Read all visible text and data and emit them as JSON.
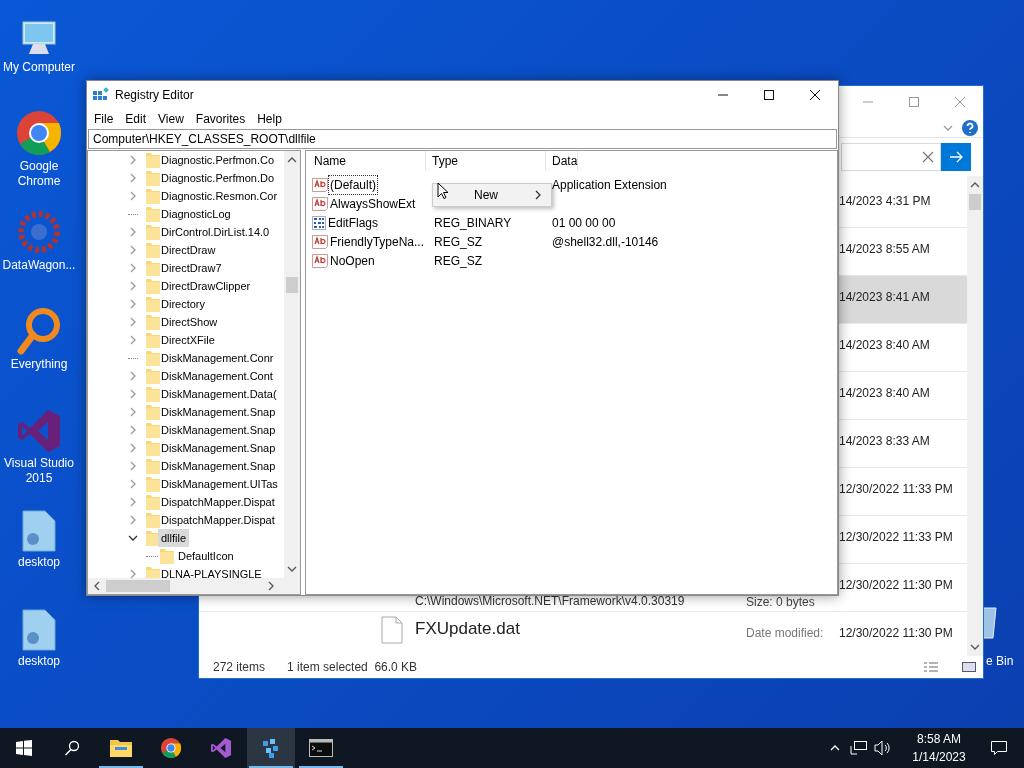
{
  "desktop_icons": [
    {
      "label": "My Computer",
      "kind": "computer"
    },
    {
      "label": "Google Chrome",
      "kind": "chrome"
    },
    {
      "label": "DataWagon...",
      "kind": "datawagon"
    },
    {
      "label": "Everything",
      "kind": "everything"
    },
    {
      "label": "Visual Studio 2015",
      "kind": "vs"
    },
    {
      "label": "desktop",
      "kind": "file"
    },
    {
      "label": "desktop",
      "kind": "file"
    }
  ],
  "recycle_bin": {
    "label": "e Bin"
  },
  "explorer": {
    "items": [
      {
        "date": "14/2023 4:31 PM",
        "selected": false
      },
      {
        "date": "14/2023 8:55 AM",
        "selected": false
      },
      {
        "date": "14/2023 8:41 AM",
        "selected": true
      },
      {
        "date": "14/2023 8:40 AM",
        "selected": false
      },
      {
        "date": "14/2023 8:40 AM",
        "selected": false
      },
      {
        "date": "14/2023 8:33 AM",
        "selected": false
      },
      {
        "date": "12/30/2022 11:33 PM",
        "selected": false
      },
      {
        "date": "12/30/2022 11:33 PM",
        "selected": false
      },
      {
        "date": "12/30/2022 11:30 PM",
        "path": "C:\\Windows\\Microsoft.NET\\Framework\\v4.0.30319",
        "size": "Size: 0 bytes",
        "selected": false
      },
      {
        "name": "FXUpdate.dat",
        "date_label": "Date modified:",
        "date": "12/30/2022 11:30 PM",
        "selected": false
      }
    ],
    "status": {
      "count": "272 items",
      "selection": "1 item selected  66.0 KB"
    }
  },
  "regedit": {
    "title": "Registry Editor",
    "menu": [
      "File",
      "Edit",
      "View",
      "Favorites",
      "Help"
    ],
    "address": "Computer\\HKEY_CLASSES_ROOT\\dllfile",
    "tree": [
      {
        "label": "Diagnostic.Perfmon.Co",
        "kind": "branch",
        "expanded": false,
        "selected": false
      },
      {
        "label": "Diagnostic.Perfmon.Do",
        "kind": "branch",
        "expanded": false,
        "selected": false
      },
      {
        "label": "Diagnostic.Resmon.Cor",
        "kind": "branch",
        "expanded": false,
        "selected": false
      },
      {
        "label": "DiagnosticLog",
        "kind": "leaf",
        "selected": false
      },
      {
        "label": "DirControl.DirList.14.0",
        "kind": "branch",
        "expanded": false,
        "selected": false
      },
      {
        "label": "DirectDraw",
        "kind": "branch",
        "expanded": false,
        "selected": false
      },
      {
        "label": "DirectDraw7",
        "kind": "branch",
        "expanded": false,
        "selected": false
      },
      {
        "label": "DirectDrawClipper",
        "kind": "branch",
        "expanded": false,
        "selected": false
      },
      {
        "label": "Directory",
        "kind": "branch",
        "expanded": false,
        "selected": false
      },
      {
        "label": "DirectShow",
        "kind": "branch",
        "expanded": false,
        "selected": false
      },
      {
        "label": "DirectXFile",
        "kind": "branch",
        "expanded": false,
        "selected": false
      },
      {
        "label": "DiskManagement.Conr",
        "kind": "leaf",
        "selected": false
      },
      {
        "label": "DiskManagement.Cont",
        "kind": "branch",
        "expanded": false,
        "selected": false
      },
      {
        "label": "DiskManagement.Data(",
        "kind": "branch",
        "expanded": false,
        "selected": false
      },
      {
        "label": "DiskManagement.Snap",
        "kind": "branch",
        "expanded": false,
        "selected": false
      },
      {
        "label": "DiskManagement.Snap",
        "kind": "branch",
        "expanded": false,
        "selected": false
      },
      {
        "label": "DiskManagement.Snap",
        "kind": "branch",
        "expanded": false,
        "selected": false
      },
      {
        "label": "DiskManagement.Snap",
        "kind": "branch",
        "expanded": false,
        "selected": false
      },
      {
        "label": "DiskManagement.UITas",
        "kind": "branch",
        "expanded": false,
        "selected": false
      },
      {
        "label": "DispatchMapper.Dispat",
        "kind": "branch",
        "expanded": false,
        "selected": false
      },
      {
        "label": "DispatchMapper.Dispat",
        "kind": "branch",
        "expanded": false,
        "selected": false
      },
      {
        "label": "dllfile",
        "kind": "branch",
        "expanded": true,
        "selected": true,
        "children": [
          {
            "label": "DefaultIcon",
            "selected": false
          }
        ]
      },
      {
        "label": "DLNA-PLAYSINGLE",
        "kind": "branch",
        "expanded": false,
        "selected": false
      }
    ],
    "columns": [
      "Name",
      "Type",
      "Data"
    ],
    "values": [
      {
        "name": "(Default)",
        "kind": "string",
        "data": "Application Extension",
        "focused": true
      },
      {
        "name": "AlwaysShowExt",
        "kind": "string",
        "focused": false
      },
      {
        "name": "EditFlags",
        "kind": "binary",
        "type": "REG_BINARY",
        "data": "01 00 00 00",
        "focused": false
      },
      {
        "name": "FriendlyTypeNa...",
        "kind": "string",
        "type": "REG_SZ",
        "data": "@shell32.dll,-10146",
        "focused": false
      },
      {
        "name": "NoOpen",
        "kind": "string",
        "type": "REG_SZ",
        "focused": false
      }
    ],
    "context_menu": [
      {
        "label": "New",
        "submenu": true
      }
    ]
  },
  "taskbar": {
    "apps": [
      {
        "kind": "explorer",
        "running": true,
        "active": false
      },
      {
        "kind": "chrome",
        "running": false,
        "active": false
      },
      {
        "kind": "vs",
        "running": false,
        "active": false
      },
      {
        "kind": "datawagon",
        "running": true,
        "active": true
      },
      {
        "kind": "terminal",
        "running": true,
        "active": false
      }
    ],
    "time": "8:58 AM",
    "date": "1/14/2023"
  }
}
